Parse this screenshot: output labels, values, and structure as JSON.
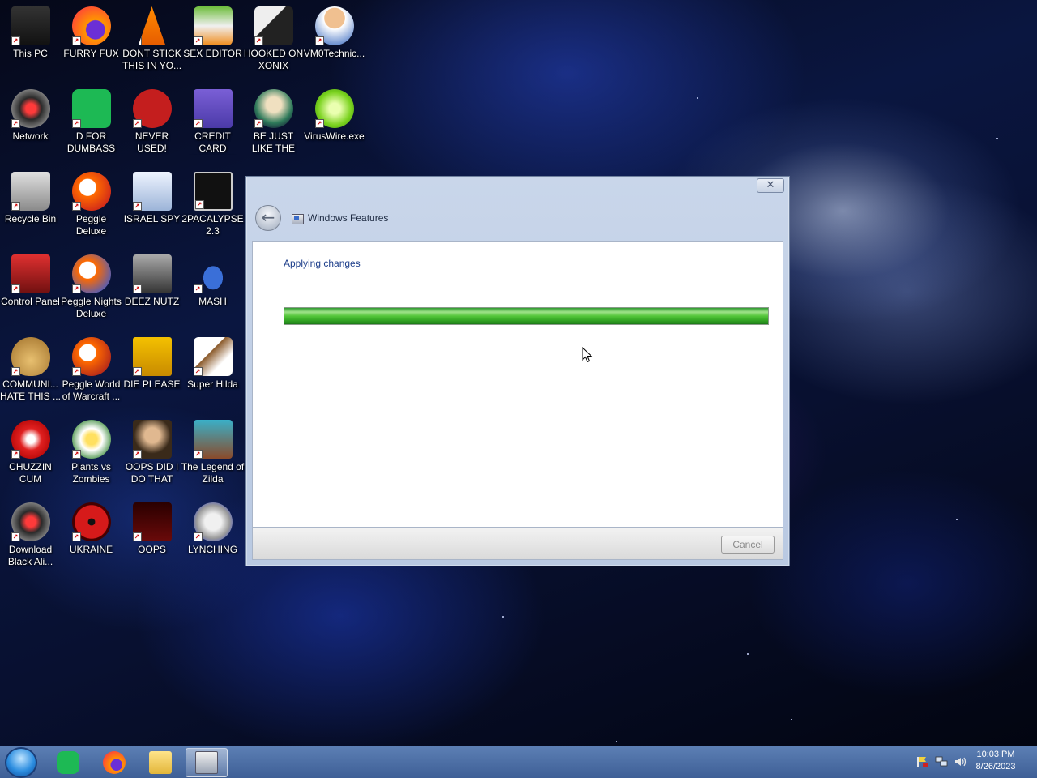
{
  "desktop": {
    "icons": [
      {
        "label": "This PC",
        "icon": "this-pc-icon"
      },
      {
        "label": "FURRY FUX",
        "icon": "firefox-icon"
      },
      {
        "label": "DONT STICK THIS IN YO...",
        "icon": "vlc-cone-icon"
      },
      {
        "label": "SEX EDITOR",
        "icon": "hxd-editor-icon"
      },
      {
        "label": "HOOKED ON XONIX",
        "icon": "xonix-game-icon"
      },
      {
        "label": "VM0Technic...",
        "icon": "doctor-icon"
      },
      {
        "label": "Network",
        "icon": "network-icon"
      },
      {
        "label": "D FOR DUMBASS",
        "icon": "spotify-icon"
      },
      {
        "label": "NEVER USED!",
        "icon": "devcpp-icon"
      },
      {
        "label": "CREDIT CARD CHECKER",
        "icon": "credit-card-icon"
      },
      {
        "label": "BE JUST LIKE THE DUDE!",
        "icon": "dude-icon"
      },
      {
        "label": "VirusWire.exe",
        "icon": "limewire-icon"
      },
      {
        "label": "Recycle Bin",
        "icon": "recycle-bin-icon"
      },
      {
        "label": "Peggle Deluxe",
        "icon": "peggle-icon"
      },
      {
        "label": "ISRAEL SPY",
        "icon": "network-spy-icon"
      },
      {
        "label": "2PACALYPSE 2.3",
        "icon": "terminal-icon"
      },
      {
        "label": "Control Panel",
        "icon": "control-panel-icon"
      },
      {
        "label": "Peggle Nights Deluxe",
        "icon": "peggle-nights-icon"
      },
      {
        "label": "DEEZ NUTZ",
        "icon": "windows-stack-icon"
      },
      {
        "label": "MASH",
        "icon": "ufo-icon"
      },
      {
        "label": "COMMUNI... HATE THIS ...",
        "icon": "money-bag-icon"
      },
      {
        "label": "Peggle World of Warcraft ...",
        "icon": "peggle-wow-icon"
      },
      {
        "label": "DIE PLEASE",
        "icon": "die-icon"
      },
      {
        "label": "Super Hilda",
        "icon": "pixel-cat-icon"
      },
      {
        "label": "CHUZZIN CUM",
        "icon": "chuzzle-icon"
      },
      {
        "label": "Plants vs Zombies",
        "icon": "plants-vs-zombies-icon"
      },
      {
        "label": "OOPS DID I DO THAT",
        "icon": "portrait-icon"
      },
      {
        "label": "The Legend of Zilda",
        "icon": "zilda-icon"
      },
      {
        "label": "Download Black Ali...",
        "icon": "alien-icon"
      },
      {
        "label": "UKRAINE",
        "icon": "radiation-icon"
      },
      {
        "label": "OOPS",
        "icon": "oops-icon"
      },
      {
        "label": "LYNCHING",
        "icon": "emblem-icon"
      }
    ]
  },
  "dialog": {
    "title": "Windows Features",
    "close_symbol": "✕",
    "back_symbol": "←",
    "status": "Applying changes",
    "progress_fraction": 1.0,
    "cancel_label": "Cancel"
  },
  "taskbar": {
    "time": "10:03 PM",
    "date": "8/26/2023"
  }
}
